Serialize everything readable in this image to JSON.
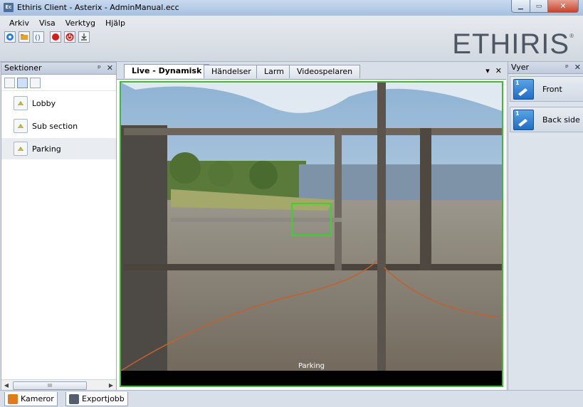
{
  "window": {
    "title": "Ethiris Client - Asterix - AdminManual.ecc",
    "app_icon_text": "Ec"
  },
  "menu": [
    "Arkiv",
    "Visa",
    "Verktyg",
    "Hjälp"
  ],
  "brand": {
    "logo": "ETHIRIS",
    "mark": "®"
  },
  "left_pane": {
    "title": "Sektioner",
    "items": [
      {
        "label": "Lobby"
      },
      {
        "label": "Sub section"
      },
      {
        "label": "Parking"
      }
    ],
    "scroll_thumb": "III"
  },
  "tabs": [
    {
      "label": "Live - Dynamisk",
      "active": true
    },
    {
      "label": "Händelser"
    },
    {
      "label": "Larm"
    },
    {
      "label": "Videospelaren"
    }
  ],
  "video": {
    "camera_label": "Parking"
  },
  "right_pane": {
    "title": "Vyer",
    "views": [
      {
        "number": "1",
        "label": "Front"
      },
      {
        "number": "1",
        "label": "Back side"
      }
    ]
  },
  "bottom_tabs": [
    {
      "label": "Kameror"
    },
    {
      "label": "Exportjobb"
    }
  ],
  "colors": {
    "accent_green": "#3cbc2e",
    "view_blue": "#1f6ec6"
  }
}
